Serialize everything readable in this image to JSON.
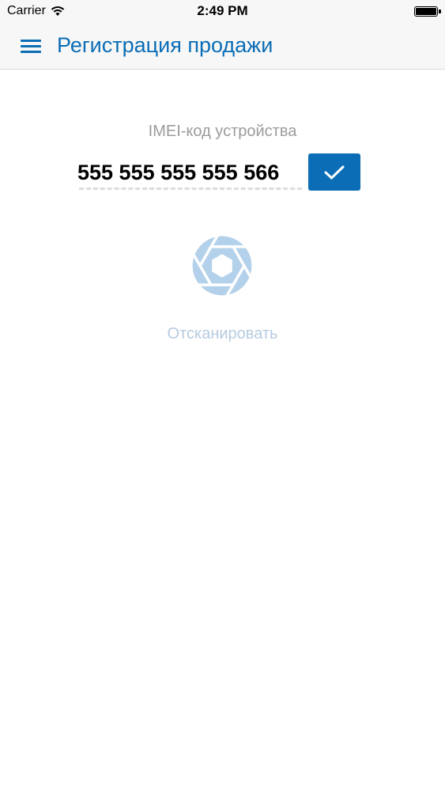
{
  "status_bar": {
    "carrier": "Carrier",
    "time": "2:49 PM",
    "wifi_icon": "wifi-icon",
    "battery_icon": "battery-icon"
  },
  "nav": {
    "title": "Регистрация продажи",
    "menu_icon": "hamburger-menu-icon",
    "accent_color": "#0a6db5"
  },
  "imei": {
    "label": "IMEI-код устройства",
    "value": "555 555 555 555 566",
    "confirm_icon": "checkmark-icon"
  },
  "scan": {
    "icon": "camera-aperture-icon",
    "label": "Отсканировать",
    "icon_color": "#b3d1ea",
    "label_color": "#b6cbe0"
  }
}
